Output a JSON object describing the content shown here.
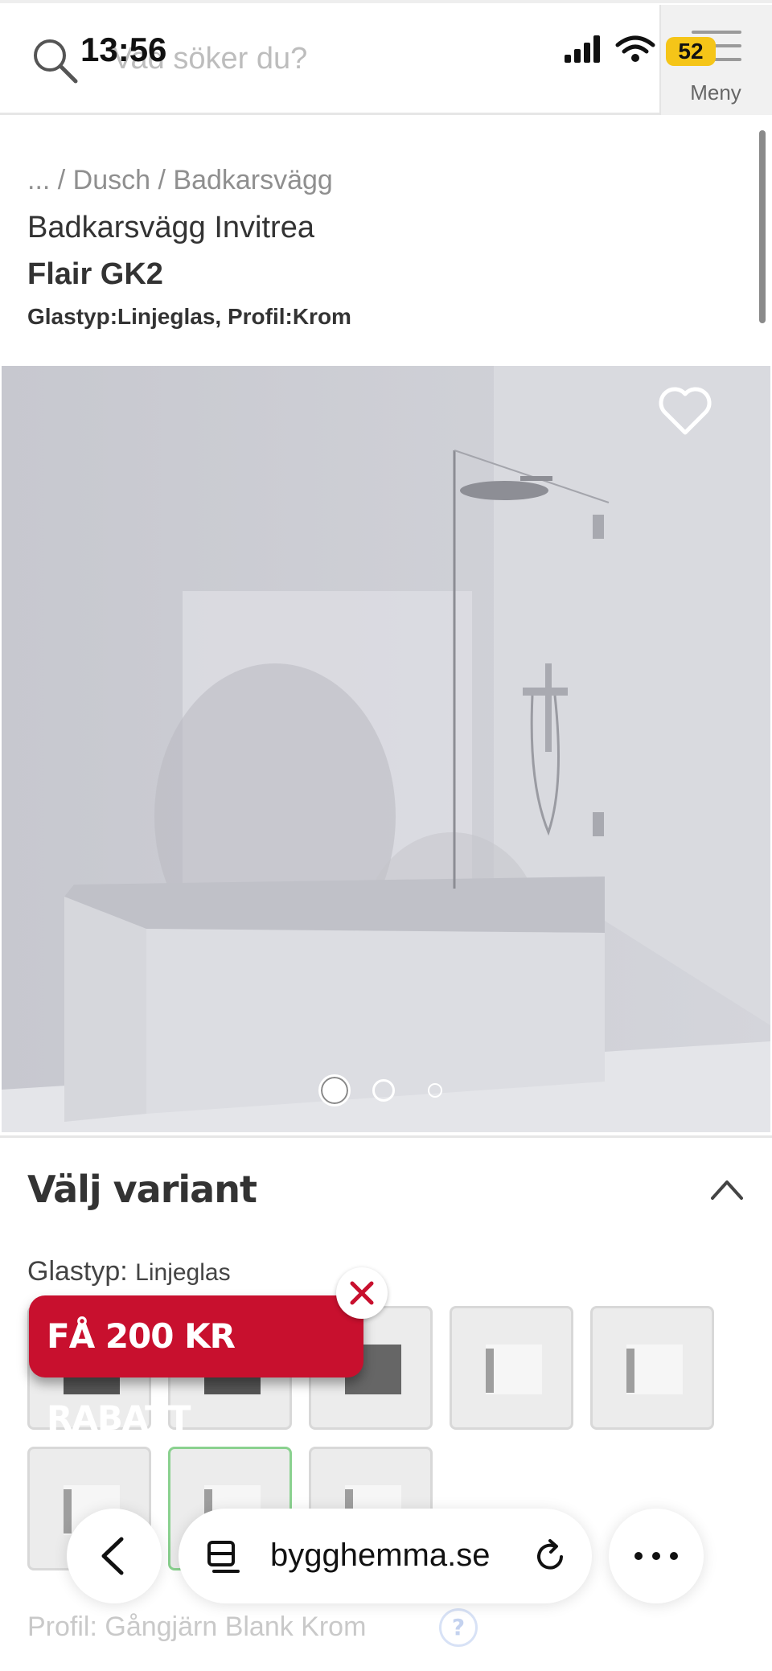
{
  "status_bar": {
    "time": "13:56",
    "battery": "52"
  },
  "header": {
    "search_placeholder": "Vad söker du?",
    "menu_label": "Meny"
  },
  "product": {
    "breadcrumb": "... / Dusch / Badkarsvägg",
    "brand_line": "Badkarsvägg Invitrea",
    "name": "Flair GK2",
    "attributes": "Glastyp:Linjeglas, Profil:Krom",
    "image_count": 3,
    "active_image": 1
  },
  "variant": {
    "title": "Välj variant",
    "glass": {
      "label": "Glastyp:",
      "value": "Linjeglas"
    },
    "profile": {
      "label": "Profil:",
      "value": "Gångjärn Blank Krom",
      "help": "?"
    }
  },
  "promo": {
    "text": "FÅ 200 KR RABATT"
  },
  "browser": {
    "url": "bygghemma.se"
  },
  "colors": {
    "promo": "#c8102e",
    "selected_border": "#8ad18f",
    "battery": "#f5c518"
  }
}
